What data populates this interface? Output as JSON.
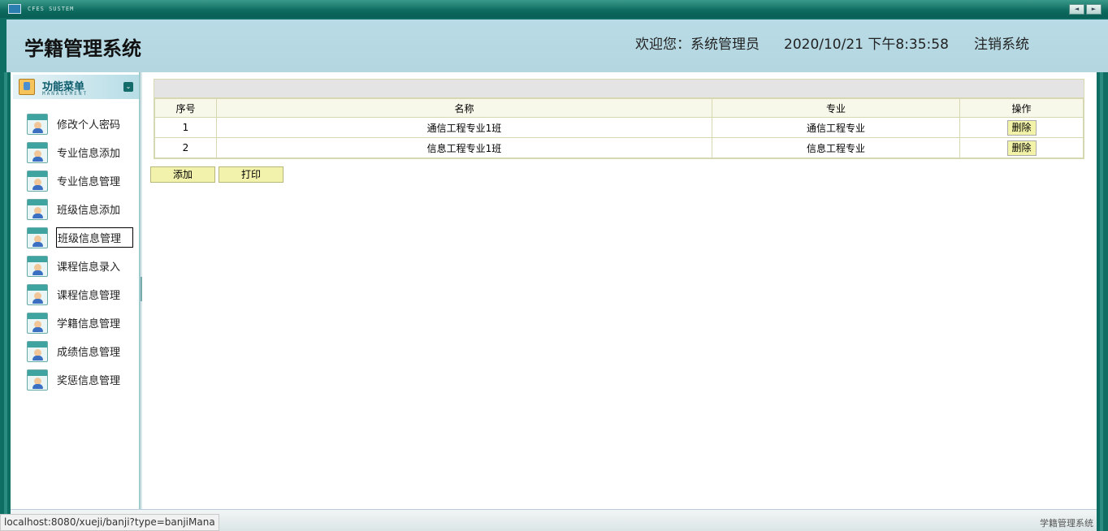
{
  "window": {
    "system_label": "CFES SUSTEM",
    "nav_prev": "◄",
    "nav_next": "►"
  },
  "header": {
    "app_title": "学籍管理系统",
    "welcome": "欢迎您：系统管理员",
    "datetime": "2020/10/21 下午8:35:58",
    "logout": "注销系统"
  },
  "sidebar": {
    "title": "功能菜单",
    "subtitle": "MANAGEMENT",
    "collapse_icon": "double-chevron-down-icon",
    "items": [
      {
        "label": "修改个人密码"
      },
      {
        "label": "专业信息添加"
      },
      {
        "label": "专业信息管理"
      },
      {
        "label": "班级信息添加"
      },
      {
        "label": "班级信息管理",
        "active": true
      },
      {
        "label": "课程信息录入"
      },
      {
        "label": "课程信息管理"
      },
      {
        "label": "学籍信息管理"
      },
      {
        "label": "成绩信息管理"
      },
      {
        "label": "奖惩信息管理"
      }
    ]
  },
  "table": {
    "headers": [
      "序号",
      "名称",
      "专业",
      "操作"
    ],
    "rows": [
      {
        "no": "1",
        "name": "通信工程专业1班",
        "major": "通信工程专业",
        "action": "删除"
      },
      {
        "no": "2",
        "name": "信息工程专业1班",
        "major": "信息工程专业",
        "action": "删除"
      }
    ]
  },
  "actions": {
    "add": "添加",
    "print": "打印"
  },
  "footer": {
    "title": "学籍管理系统"
  },
  "status_bar": {
    "url": "localhost:8080/xueji/banji?type=banjiMana"
  }
}
